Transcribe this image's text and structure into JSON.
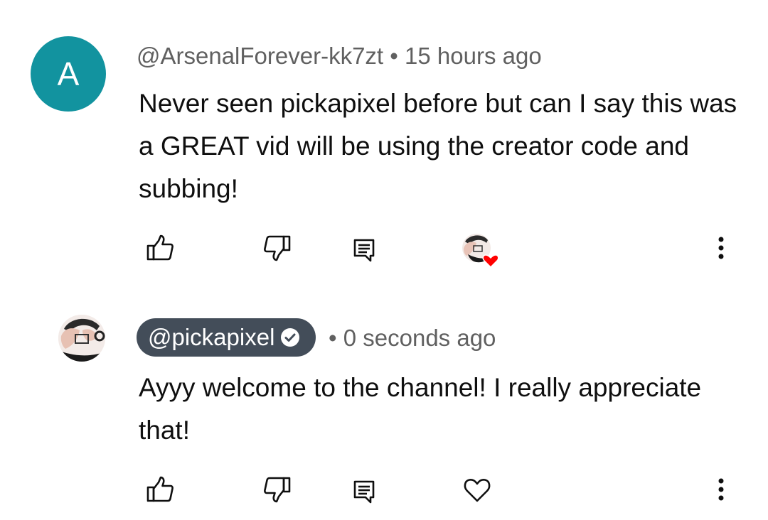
{
  "comment": {
    "avatar_letter": "A",
    "author": "@ArsenalForever-kk7zt",
    "separator": "•",
    "time": "15 hours ago",
    "text": "Never seen pickapixel before but can I say this was a GREAT vid will be using the creator code and subbing!",
    "actions": {
      "like_icon": "thumb-up-icon",
      "dislike_icon": "thumb-down-icon",
      "reply_icon": "reply-comment-icon",
      "hearted_icon": "creator-heart-icon",
      "more_icon": "more-vertical-icon"
    }
  },
  "reply": {
    "author": "@pickapixel",
    "verified_icon": "verified-check-icon",
    "separator": "•",
    "time": "0 seconds ago",
    "text": "Ayyy welcome to the channel! I really appreciate that!",
    "actions": {
      "like_icon": "thumb-up-icon",
      "dislike_icon": "thumb-down-icon",
      "reply_icon": "reply-comment-icon",
      "heart_icon": "heart-outline-icon",
      "more_icon": "more-vertical-icon"
    }
  },
  "colors": {
    "avatar_bg": "#12939f",
    "chip_bg": "#434d59",
    "meta_text": "#606060",
    "body_text": "#0f0f0f",
    "heart": "#ff0000"
  }
}
